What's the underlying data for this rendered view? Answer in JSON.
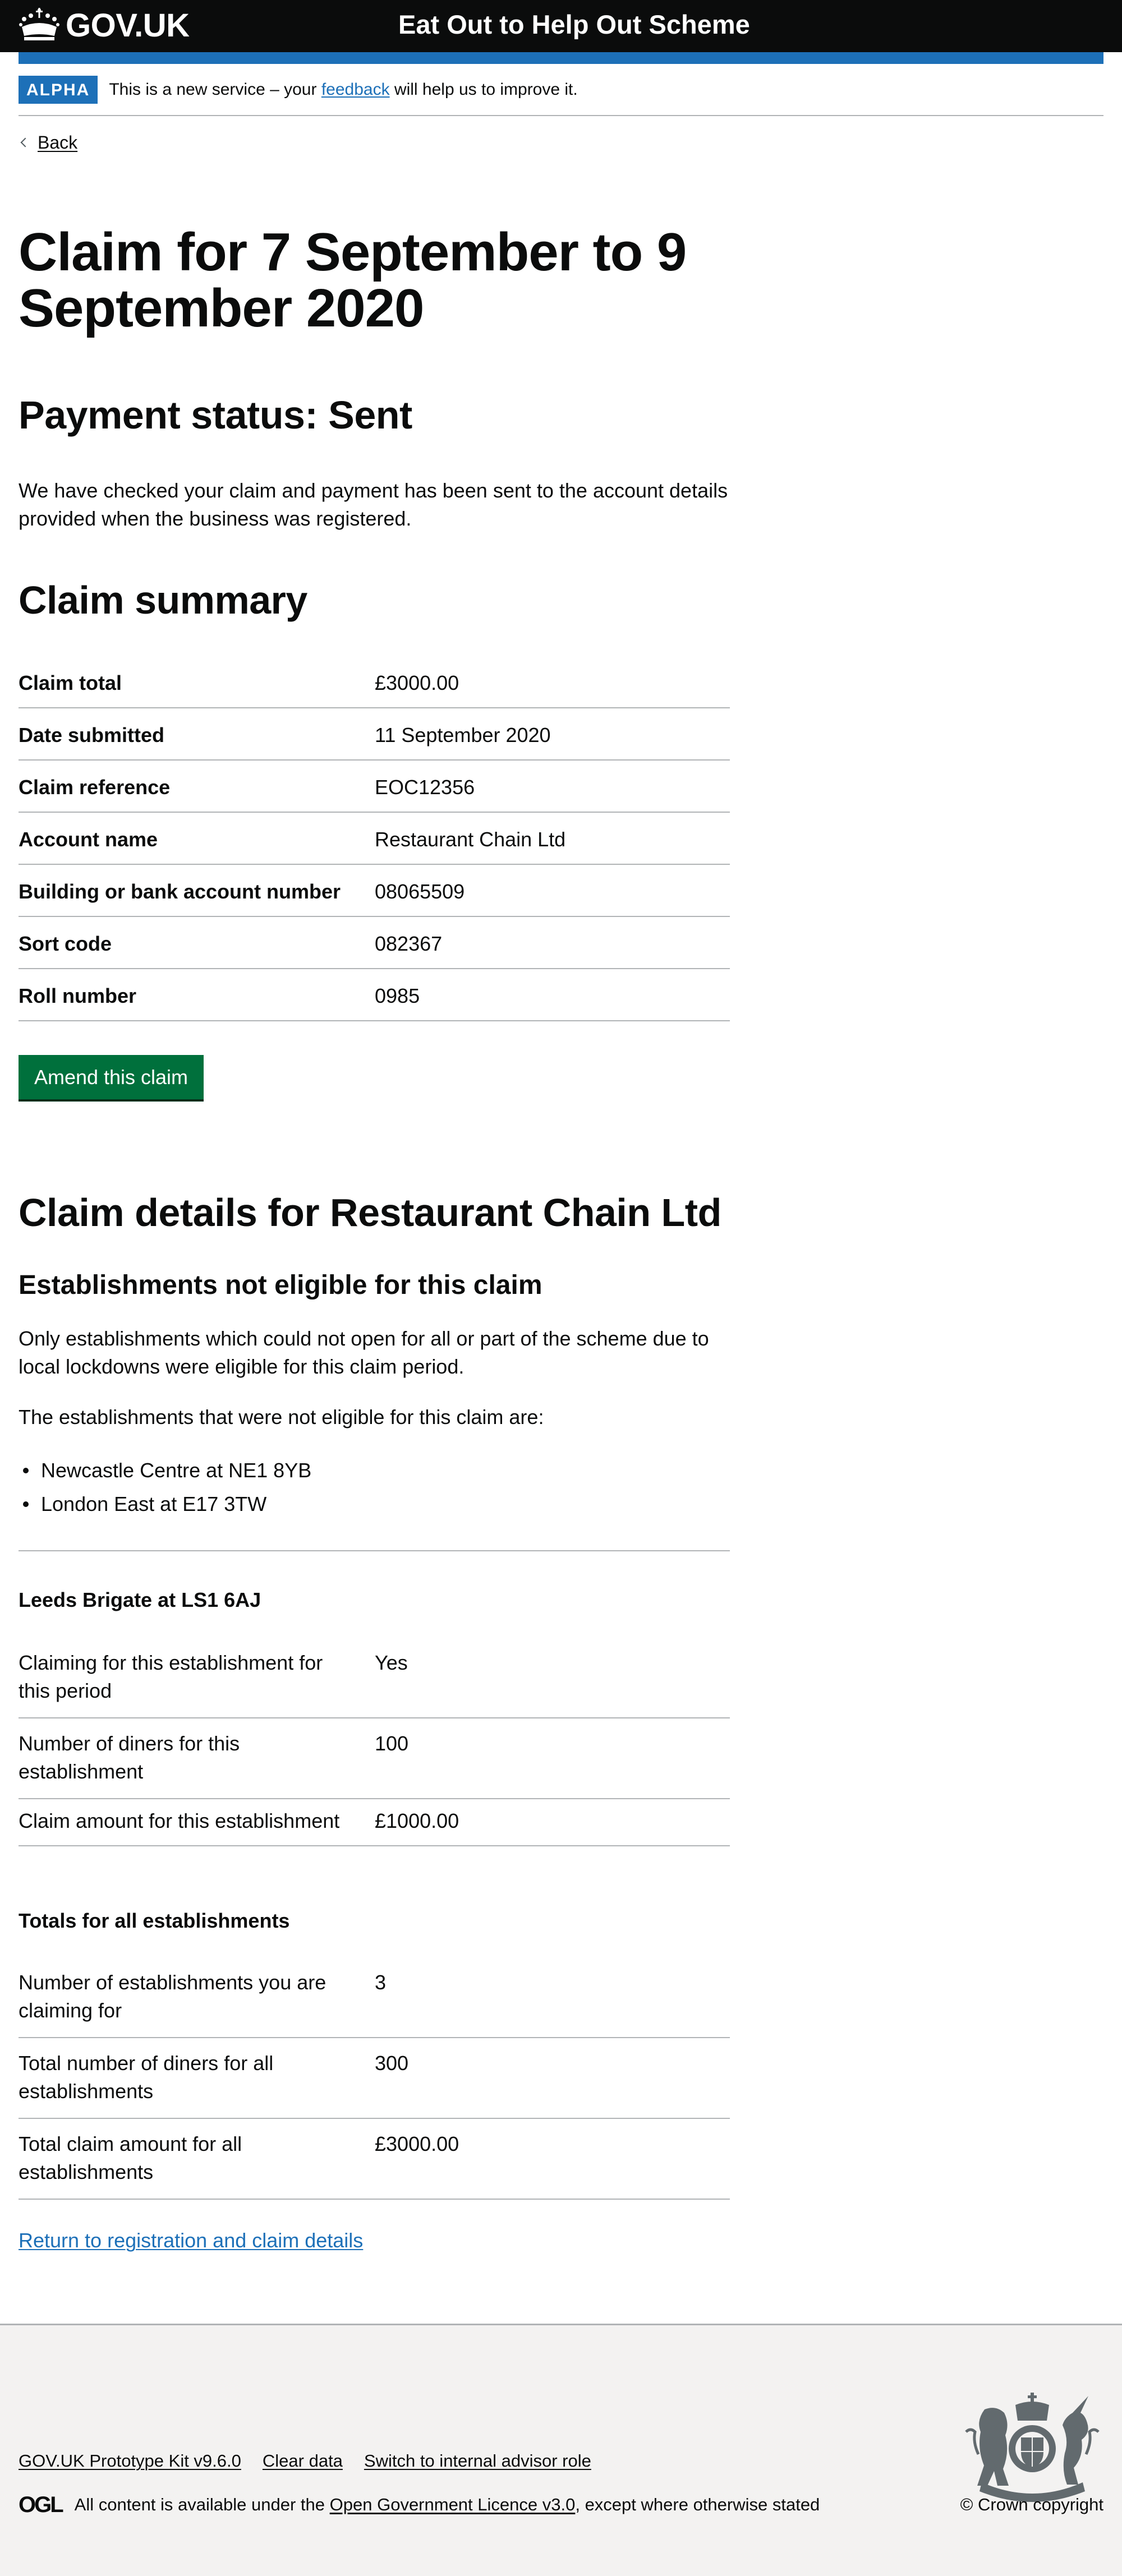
{
  "header": {
    "logo_text": "GOV.UK",
    "service_name": "Eat Out to Help Out Scheme"
  },
  "phase_banner": {
    "tag": "ALPHA",
    "text_before": "This is a new service – your ",
    "link": "feedback",
    "text_after": " will help us to improve it."
  },
  "back_link": "Back",
  "page_title": "Claim for 7 September to 9 September 2020",
  "payment_status": {
    "heading": "Payment status: Sent",
    "body": "We have checked your claim and payment has been sent to the account details provided when the business was registered."
  },
  "claim_summary": {
    "heading": "Claim summary",
    "rows": [
      {
        "key": "Claim total",
        "value": "£3000.00"
      },
      {
        "key": "Date submitted",
        "value": "11 September 2020"
      },
      {
        "key": "Claim reference",
        "value": "EOC12356"
      },
      {
        "key": "Account name",
        "value": "Restaurant Chain Ltd"
      },
      {
        "key": "Building or bank account number",
        "value": "08065509"
      },
      {
        "key": "Sort code",
        "value": "082367"
      },
      {
        "key": "Roll number",
        "value": "0985"
      }
    ],
    "amend_button": "Amend this claim"
  },
  "claim_details": {
    "heading": "Claim details for Restaurant Chain Ltd",
    "not_eligible": {
      "heading": "Establishments not eligible for this claim",
      "intro": "Only establishments which could not open for all or part of the scheme due to local lockdowns were eligible for this claim period.",
      "list_intro": "The establishments that were not eligible for this claim are:",
      "items": [
        "Newcastle Centre at NE1 8YB",
        "London East at E17 3TW"
      ]
    },
    "establishment": {
      "heading": "Leeds Brigate at LS1 6AJ",
      "rows": [
        {
          "key": "Claiming for this establishment for this period",
          "value": "Yes"
        },
        {
          "key": "Number of diners for this establishment",
          "value": "100"
        },
        {
          "key": "Claim amount for this establishment",
          "value": "£1000.00"
        }
      ]
    },
    "totals": {
      "heading": "Totals for all establishments",
      "rows": [
        {
          "key": "Number of establishments you are claiming for",
          "value": "3"
        },
        {
          "key": "Total number of diners for all establishments",
          "value": "300"
        },
        {
          "key": "Total claim amount for all establishments",
          "value": "£3000.00"
        }
      ]
    },
    "return_link": "Return to registration and claim details"
  },
  "footer": {
    "links": [
      "GOV.UK Prototype Kit v9.6.0",
      "Clear data",
      "Switch to internal advisor role"
    ],
    "ogl_logo": "OGL",
    "licence_before": "All content is available under the ",
    "licence_link": "Open Government Licence v3.0",
    "licence_after": ", except where otherwise stated",
    "copyright": "© Crown copyright"
  },
  "colors": {
    "header_bg": "#0b0c0c",
    "brand_blue": "#1d70b8",
    "button_green": "#00703c",
    "border_grey": "#b1b4b6",
    "footer_bg": "#f3f2f1"
  }
}
